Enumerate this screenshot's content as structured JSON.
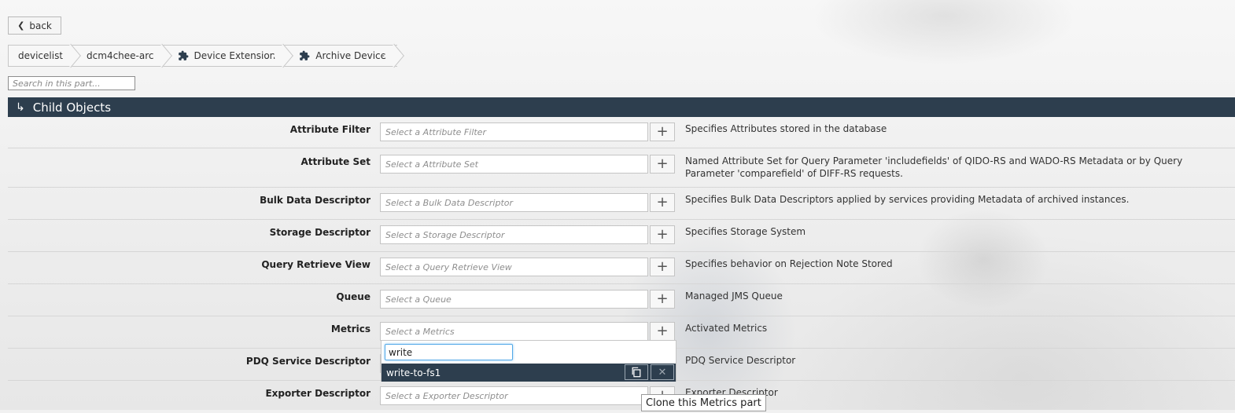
{
  "nav": {
    "back_label": "back",
    "breadcrumb": [
      {
        "label": "devicelist",
        "icon": ""
      },
      {
        "label": "dcm4chee-arc",
        "icon": ""
      },
      {
        "label": "Device Extension",
        "icon": "puzzle-icon"
      },
      {
        "label": "Archive Device",
        "icon": "puzzle-icon"
      }
    ]
  },
  "search": {
    "placeholder": "Search in this part..."
  },
  "section": {
    "title": "Child Objects"
  },
  "rows": [
    {
      "label": "Attribute Filter",
      "placeholder": "Select a Attribute Filter",
      "description": "Specifies Attributes stored in the database"
    },
    {
      "label": "Attribute Set",
      "placeholder": "Select a Attribute Set",
      "description": "Named Attribute Set for Query Parameter 'includefields' of QIDO-RS and WADO-RS Metadata or by Query Parameter 'comparefield' of DIFF-RS requests."
    },
    {
      "label": "Bulk Data Descriptor",
      "placeholder": "Select a Bulk Data Descriptor",
      "description": "Specifies Bulk Data Descriptors applied by services providing Metadata of archived instances."
    },
    {
      "label": "Storage Descriptor",
      "placeholder": "Select a Storage Descriptor",
      "description": "Specifies Storage System"
    },
    {
      "label": "Query Retrieve View",
      "placeholder": "Select a Query Retrieve View",
      "description": "Specifies behavior on Rejection Note Stored"
    },
    {
      "label": "Queue",
      "placeholder": "Select a Queue",
      "description": "Managed JMS Queue"
    },
    {
      "label": "Metrics",
      "placeholder": "Select a Metrics",
      "description": "Activated Metrics"
    },
    {
      "label": "PDQ Service Descriptor",
      "placeholder": "",
      "description": "PDQ Service Descriptor"
    },
    {
      "label": "Exporter Descriptor",
      "placeholder": "Select a Exporter Descriptor",
      "description": "Exporter Descriptor"
    }
  ],
  "dropdown": {
    "filter_value": "write",
    "options": [
      {
        "label": "write-to-fs1"
      }
    ]
  },
  "tooltip": {
    "text": "Clone this Metrics part"
  },
  "colors": {
    "header_bg": "#2d3e4e",
    "focus_border": "#52a9e8"
  }
}
